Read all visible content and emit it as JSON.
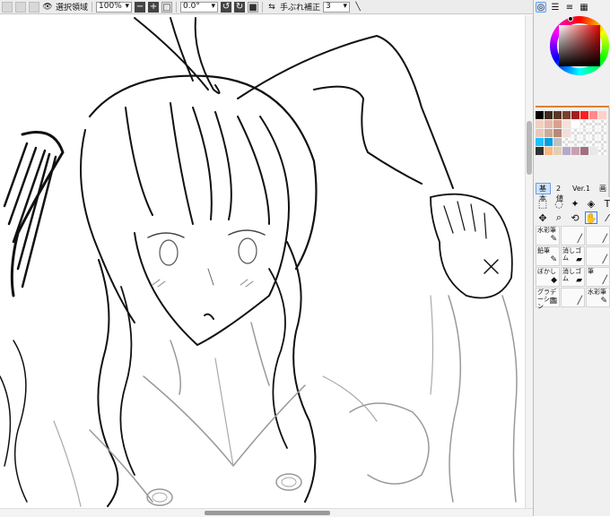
{
  "toolbar": {
    "selection_label": "選択領域",
    "zoom_value": "100%",
    "rotation_value": "0.0°",
    "stabilizer_label": "手ぶれ補正",
    "stabilizer_value": "3"
  },
  "right_panel": {
    "tool_tabs": [
      "基本",
      "2値",
      "Ver.1",
      "画"
    ],
    "brushes": [
      {
        "label": "水彩筆"
      },
      {
        "label": ""
      },
      {
        "label": ""
      },
      {
        "label": "鉛筆"
      },
      {
        "label": "消しゴム"
      },
      {
        "label": ""
      },
      {
        "label": "ぼかし"
      },
      {
        "label": "消しゴム"
      },
      {
        "label": "筆"
      },
      {
        "label": "グラデーション"
      },
      {
        "label": ""
      },
      {
        "label": "水彩筆"
      }
    ],
    "swatch_colors": [
      "#000000",
      "#3c2a20",
      "#5a3828",
      "#7a4030",
      "#a02020",
      "#ff2020",
      "#ff8a8a",
      "#ffd0c8",
      "#f0d0c0",
      "#e8b8a8",
      "#d8a090",
      "#f8e0d8",
      "#ffffff",
      "#ffffff",
      "#ffffff",
      "#ffffff",
      "#e8c8b8",
      "#d0a898",
      "#b88878",
      "#f0e0d8",
      "#ffffff",
      "#ffffff",
      "#ffffff",
      "#ffffff",
      "#20c0ff",
      "#00a0e0",
      "#c0c0c0",
      "#ffffff",
      "#ffffff",
      "#ffffff",
      "#ffffff",
      "#ffffff",
      "#303030",
      "#f8b880",
      "#e0d0b0",
      "#b8a8c8",
      "#c8a0b0",
      "#a07080",
      "#e8e8e8",
      "#ffffff"
    ]
  },
  "colors": {
    "accent": "#e08030",
    "active_tab": "#cfe2ff"
  }
}
